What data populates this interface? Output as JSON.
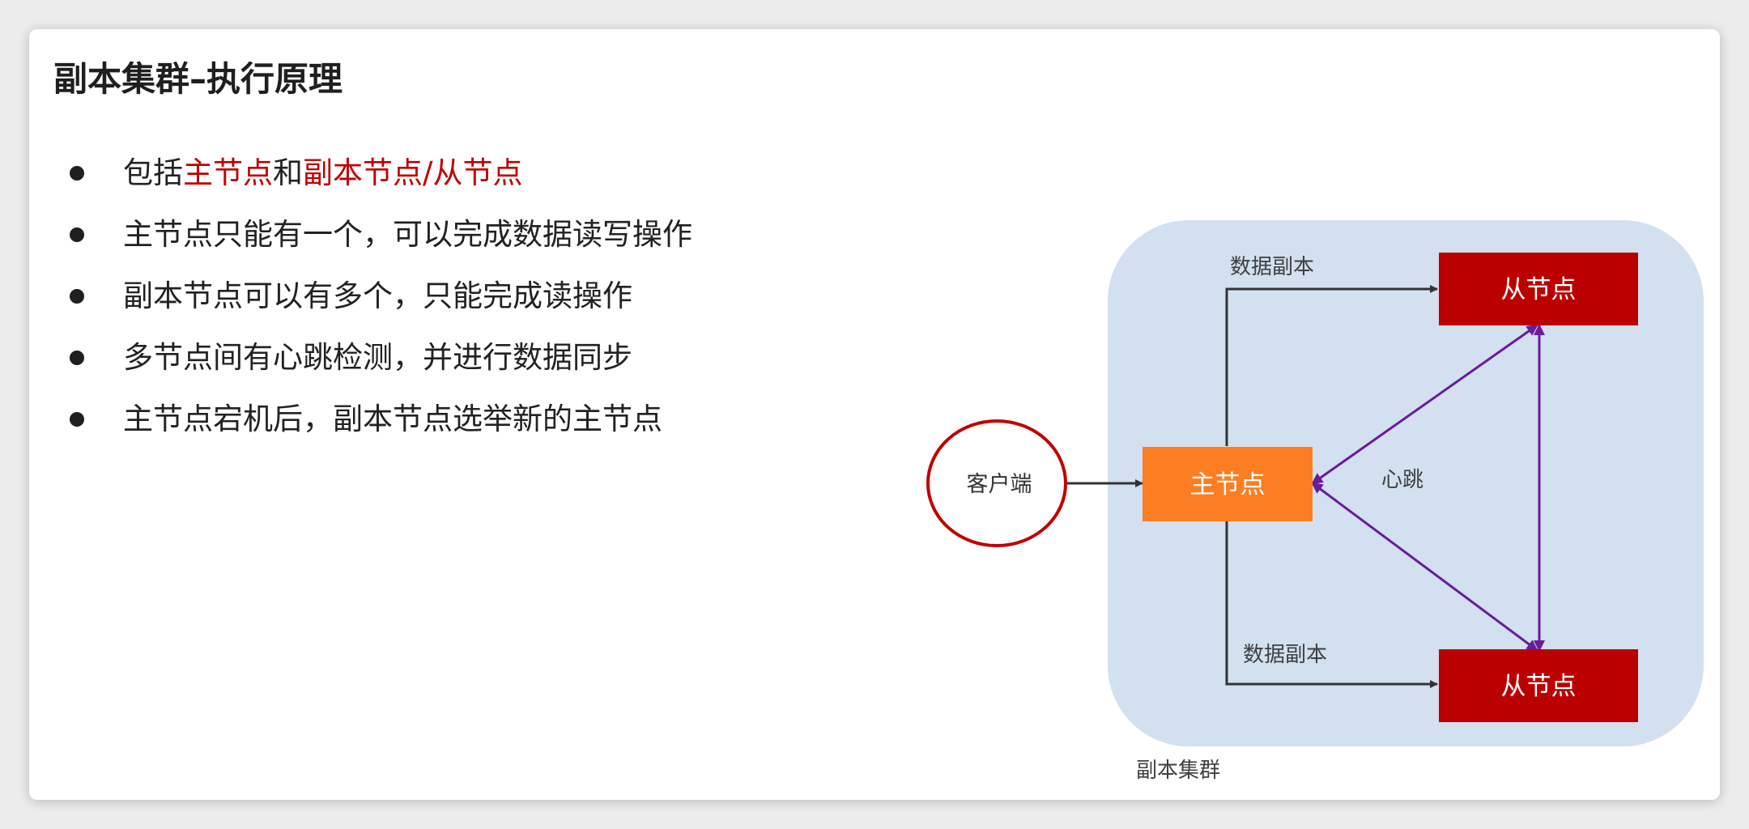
{
  "title": "副本集群–执行原理",
  "bullets": [
    {
      "parts": [
        {
          "text": "包括",
          "highlight": false
        },
        {
          "text": "主节点",
          "highlight": true
        },
        {
          "text": "和",
          "highlight": false
        },
        {
          "text": "副本节点/从节点",
          "highlight": true
        }
      ]
    },
    {
      "parts": [
        {
          "text": "主节点只能有一个，可以完成数据读写操作",
          "highlight": false
        }
      ]
    },
    {
      "parts": [
        {
          "text": "副本节点可以有多个，只能完成读操作",
          "highlight": false
        }
      ]
    },
    {
      "parts": [
        {
          "text": "多节点间有心跳检测，并进行数据同步",
          "highlight": false
        }
      ]
    },
    {
      "parts": [
        {
          "text": "主节点宕机后，副本节点选举新的主节点",
          "highlight": false
        }
      ]
    }
  ],
  "diagram": {
    "client_label": "客户端",
    "primary_label": "主节点",
    "secondary_top_label": "从节点",
    "secondary_bottom_label": "从节点",
    "replica_top_label": "数据副本",
    "replica_bottom_label": "数据副本",
    "heartbeat_label": "心跳",
    "cluster_label": "副本集群"
  },
  "colors": {
    "highlight": "#c00000",
    "cluster_bg": "#d2e0f0",
    "primary": "#fd7e22",
    "secondary": "#bb0000",
    "client_border": "#c00000",
    "heartbeat_arrow": "#6a1b9a",
    "connector": "#333333"
  }
}
